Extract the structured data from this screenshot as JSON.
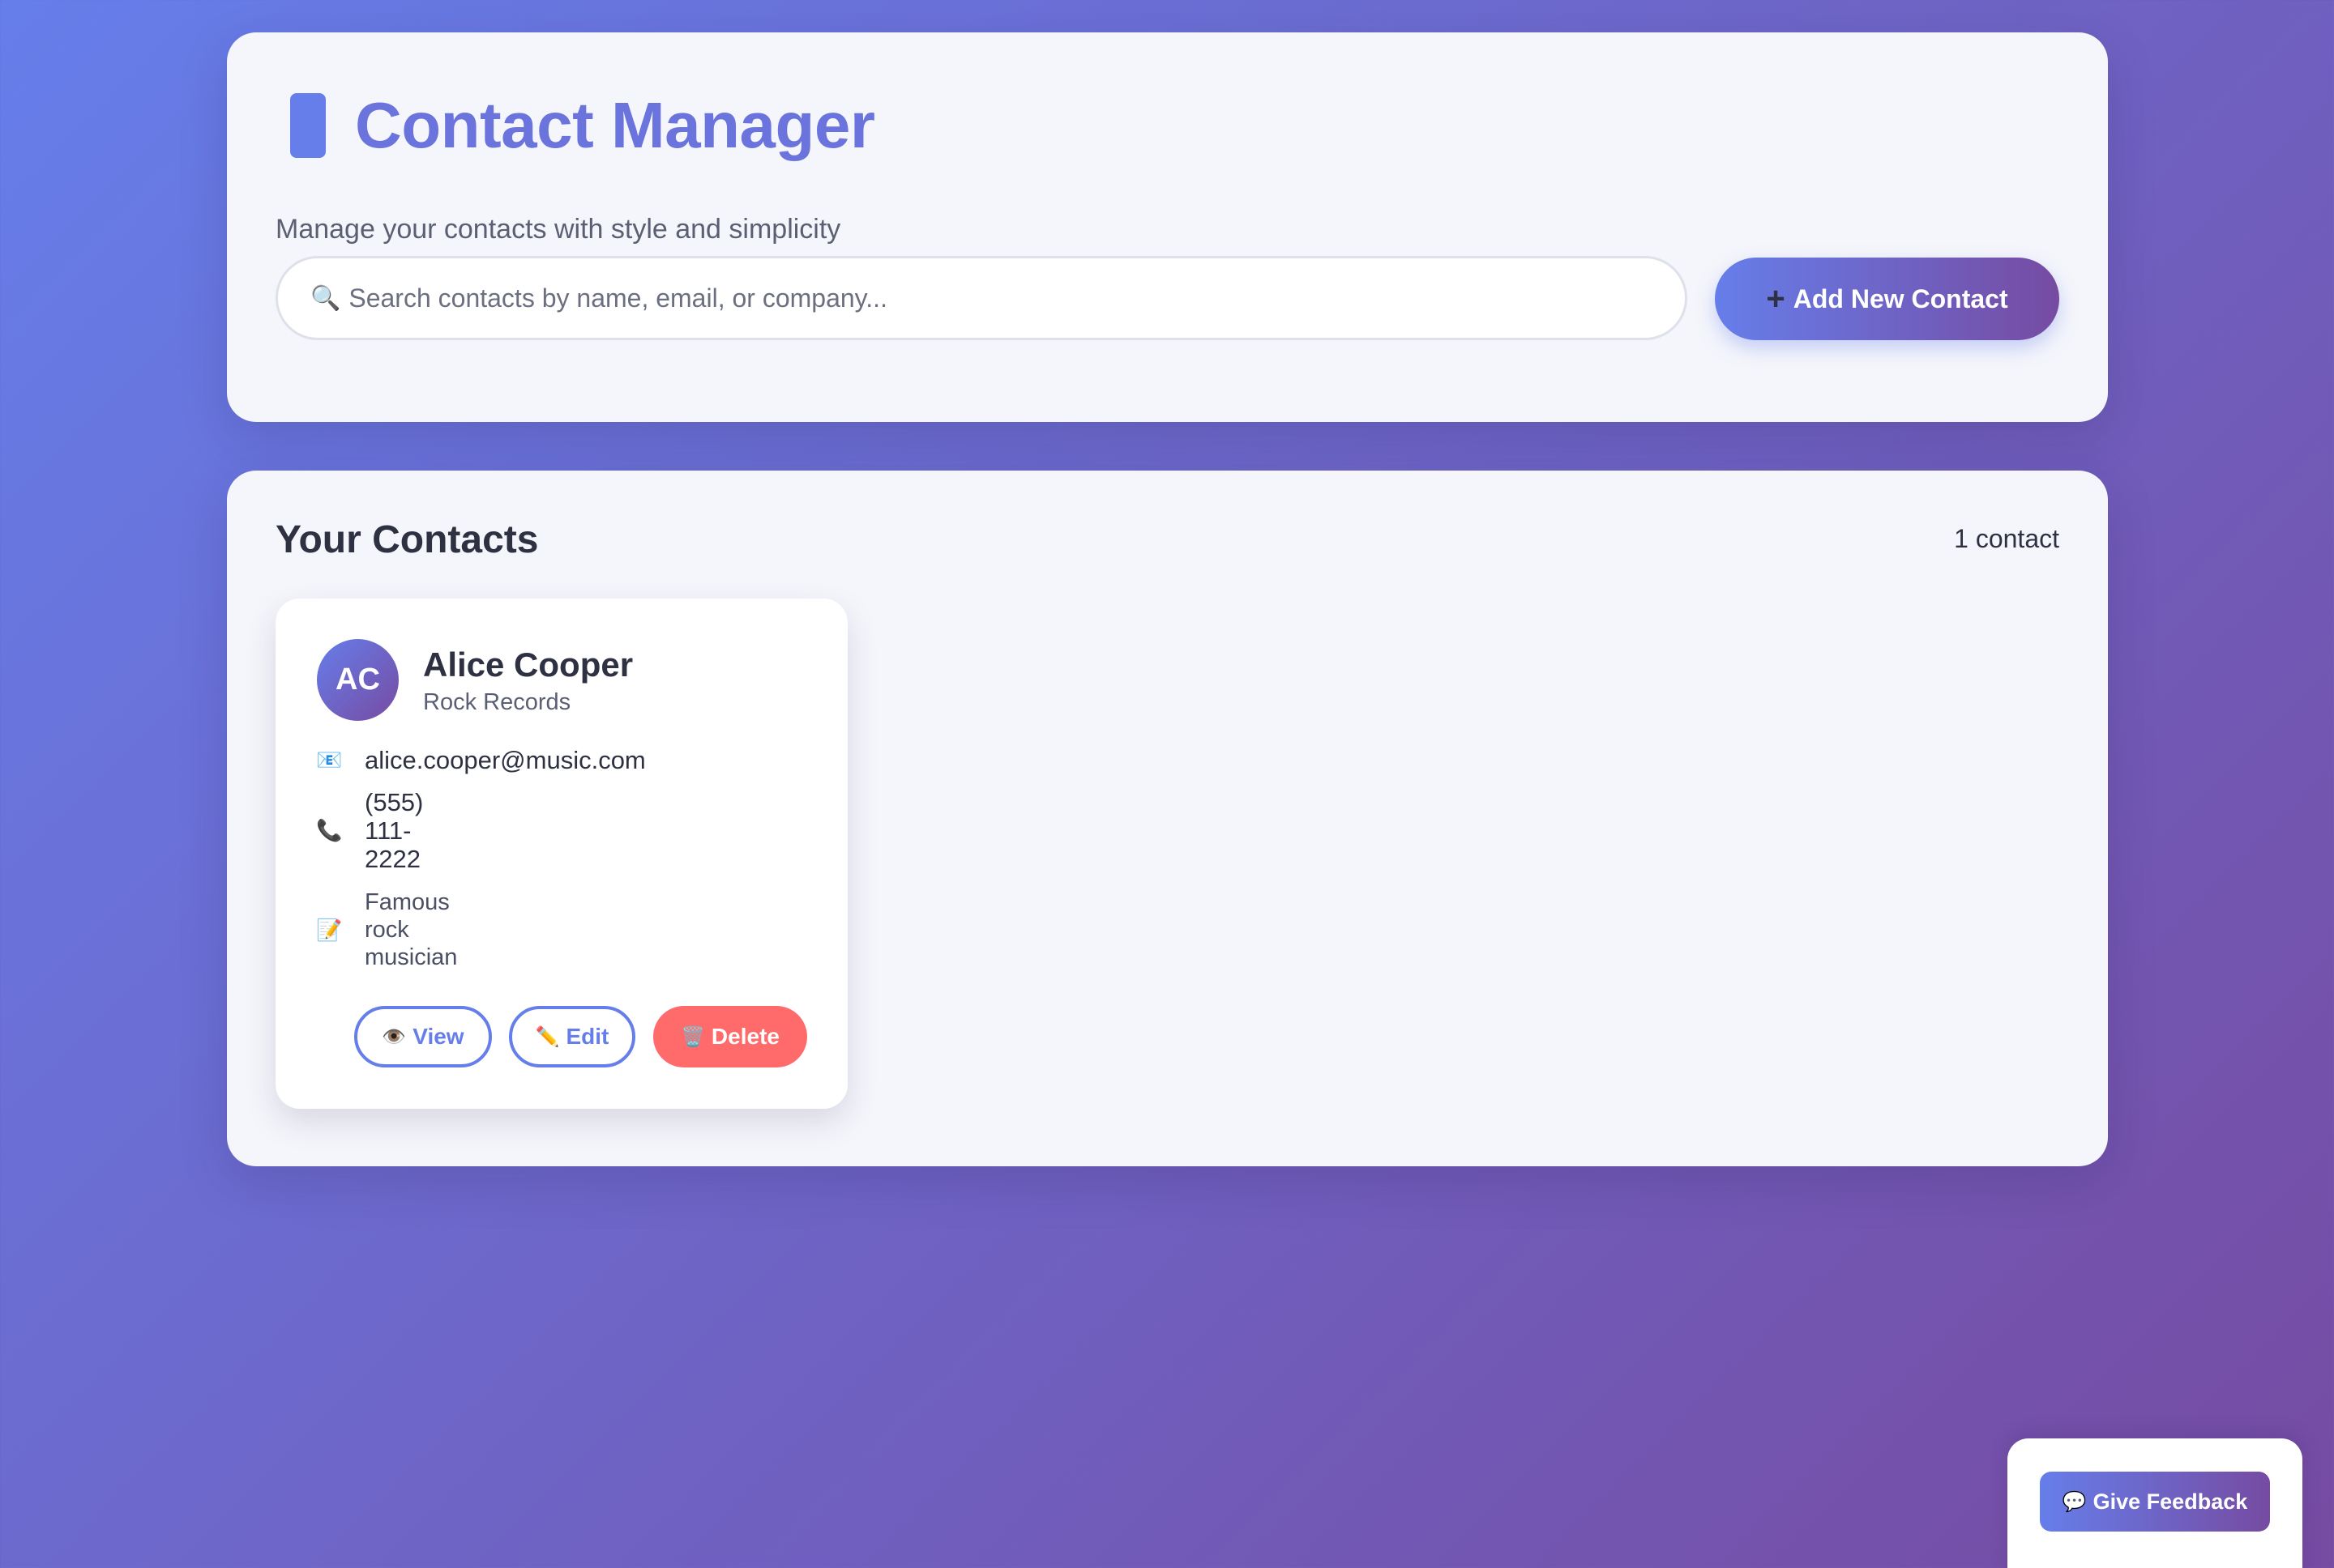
{
  "header": {
    "title": "Contact Manager",
    "icon": "mobile-phone-icon",
    "subtitle": "Manage your contacts with style and simplicity",
    "search": {
      "icon": "🔍",
      "placeholder": "Search contacts by name, email, or company...",
      "value": ""
    },
    "add_button": {
      "icon": "+",
      "label": "Add New Contact"
    }
  },
  "contacts_section": {
    "title": "Your Contacts",
    "count_label": "1 contact",
    "contacts": [
      {
        "initials": "AC",
        "name": "Alice Cooper",
        "company": "Rock Records",
        "email_icon": "📧",
        "email": "alice.cooper@music.com",
        "phone_icon": "📞",
        "phone": "(555) 111-2222",
        "notes_icon": "📝",
        "notes": "Famous rock musician",
        "actions": {
          "view_icon": "👁️",
          "view_label": "View",
          "edit_icon": "✏️",
          "edit_label": "Edit",
          "delete_icon": "🗑️",
          "delete_label": "Delete"
        }
      }
    ]
  },
  "feedback": {
    "icon": "💬",
    "label": "Give Feedback"
  },
  "colors": {
    "accent": "#667eea",
    "accent_end": "#764ba2",
    "danger": "#ff6b6b"
  }
}
